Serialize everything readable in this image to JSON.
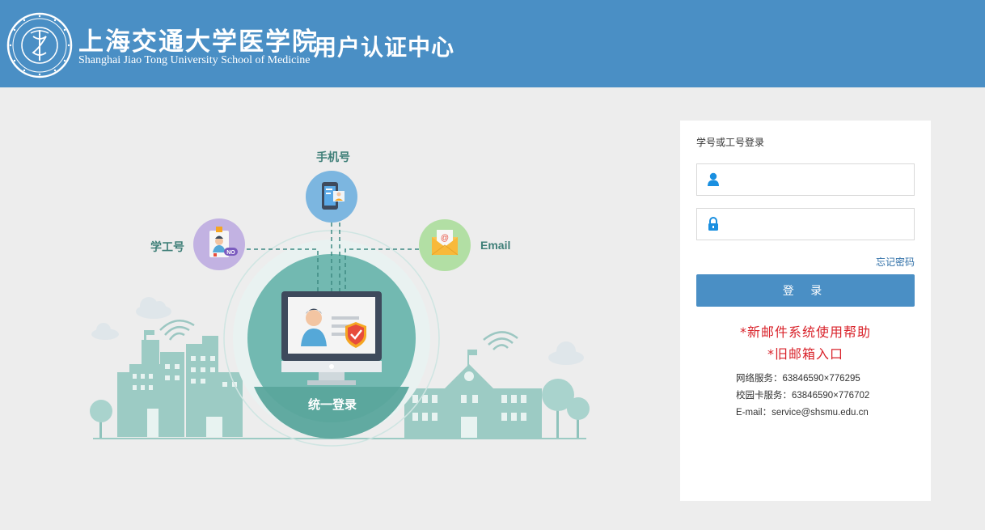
{
  "header": {
    "university_cn": "上海交通大学医学院",
    "university_en": "Shanghai Jiao Tong University School of Medicine",
    "system_title": "用户认证中心"
  },
  "illustration": {
    "label_phone": "手机号",
    "label_staff_id": "学工号",
    "label_email": "Email",
    "center_label": "统一登录",
    "badge_no": "NO"
  },
  "login": {
    "title": "学号或工号登录",
    "username_value": "",
    "password_value": "",
    "forgot_password": "忘记密码",
    "login_button": "登 录",
    "new_mail_help": "*新邮件系统使用帮助",
    "old_mail_entry": "*旧邮箱入口",
    "network_service": "网络服务：63846590×776295",
    "campus_card_service": "校园卡服务：63846590×776702",
    "email_contact": "E-mail：service@shsmu.edu.cn"
  },
  "colors": {
    "header_bg": "#4a8fc5",
    "page_bg": "#ededed",
    "accent_teal": "#6bb5ae",
    "link_red": "#d9232b"
  }
}
